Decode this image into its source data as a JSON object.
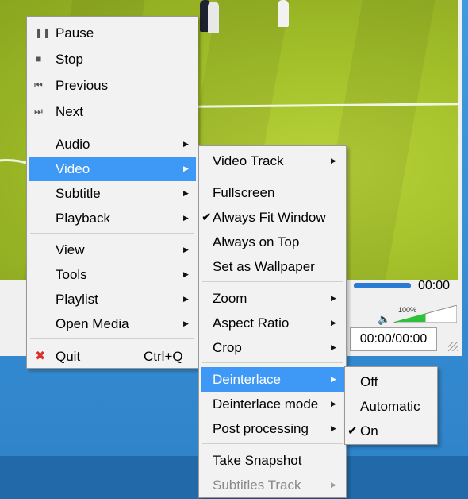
{
  "player": {
    "elapsed_time": "00:00",
    "time_display": "00:00/00:00",
    "volume_percent": "100%",
    "volume_level": 0.5
  },
  "main_menu": {
    "items": [
      {
        "label": "Pause",
        "icon": "pause-icon"
      },
      {
        "label": "Stop",
        "icon": "stop-icon"
      },
      {
        "label": "Previous",
        "icon": "previous-icon"
      },
      {
        "label": "Next",
        "icon": "next-icon"
      },
      {
        "label": "Audio"
      },
      {
        "label": "Video"
      },
      {
        "label": "Subtitle"
      },
      {
        "label": "Playback"
      },
      {
        "label": "View"
      },
      {
        "label": "Tools"
      },
      {
        "label": "Playlist"
      },
      {
        "label": "Open Media"
      },
      {
        "label": "Quit",
        "icon": "quit-icon",
        "shortcut": "Ctrl+Q"
      }
    ]
  },
  "video_menu": {
    "items": [
      {
        "label": "Video Track"
      },
      {
        "label": "Fullscreen"
      },
      {
        "label": "Always Fit Window",
        "checked": true
      },
      {
        "label": "Always on Top"
      },
      {
        "label": "Set as Wallpaper"
      },
      {
        "label": "Zoom"
      },
      {
        "label": "Aspect Ratio"
      },
      {
        "label": "Crop"
      },
      {
        "label": "Deinterlace"
      },
      {
        "label": "Deinterlace mode"
      },
      {
        "label": "Post processing"
      },
      {
        "label": "Take Snapshot"
      },
      {
        "label": "Subtitles Track",
        "disabled": true
      }
    ]
  },
  "deinterlace_menu": {
    "items": [
      {
        "label": "Off"
      },
      {
        "label": "Automatic"
      },
      {
        "label": "On",
        "checked": true
      }
    ]
  },
  "colors": {
    "highlight": "#3d99f5",
    "menu_bg": "#f2f2f2",
    "quit_icon": "#d9342b"
  }
}
